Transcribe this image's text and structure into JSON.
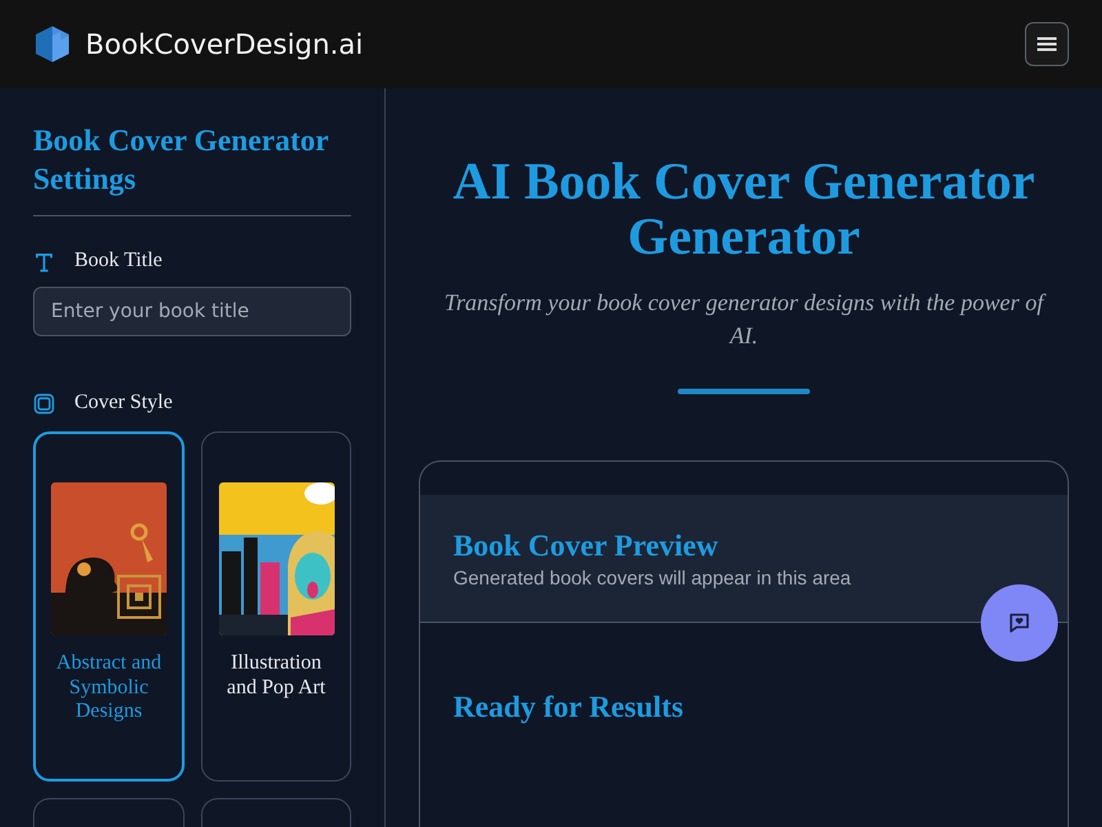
{
  "header": {
    "brand": "BookCoverDesign.ai"
  },
  "sidebar": {
    "title": "Book Cover Generator Settings",
    "book_title": {
      "label": "Book Title",
      "placeholder": "Enter your book title"
    },
    "cover_style": {
      "label": "Cover Style",
      "styles": [
        {
          "label": "Abstract and Symbolic Designs",
          "kind": "abstract",
          "selected": true
        },
        {
          "label": "Illustration and Pop Art",
          "kind": "pop",
          "selected": false
        },
        {
          "kind": "empty",
          "selected": false
        },
        {
          "kind": "empty",
          "selected": false
        }
      ]
    }
  },
  "main": {
    "title": "AI Book Cover Generator Generator",
    "subtitle": "Transform your book cover generator designs with the power of AI.",
    "preview": {
      "title": "Book Cover Preview",
      "subtitle": "Generated book covers will appear in this area",
      "status": "Ready for Results"
    }
  }
}
